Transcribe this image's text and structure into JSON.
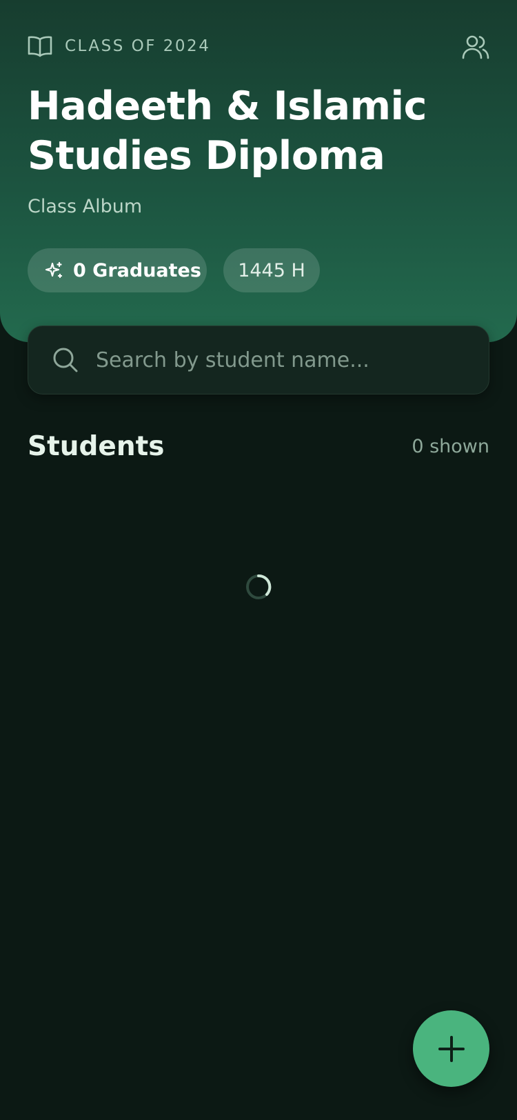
{
  "header": {
    "class_label": "CLASS OF 2024",
    "title": "Hadeeth & Islamic Studies Diploma",
    "subtitle": "Class Album",
    "graduates_chip": "0 Graduates",
    "year_chip": "1445 H",
    "icons": {
      "leading": "open-book-icon",
      "action": "people-icon",
      "chip": "sparkle-icon"
    }
  },
  "search": {
    "placeholder": "Search by student name...",
    "value": "",
    "icon": "search-icon"
  },
  "students": {
    "heading": "Students",
    "count_label": "0 shown",
    "loading": true
  },
  "fab": {
    "icon": "plus-icon",
    "color": "#4ab47e"
  },
  "colors": {
    "background": "#0c1914",
    "header_top": "#173d2f",
    "header_bottom": "#236a4e",
    "accent": "#4ab47e"
  }
}
